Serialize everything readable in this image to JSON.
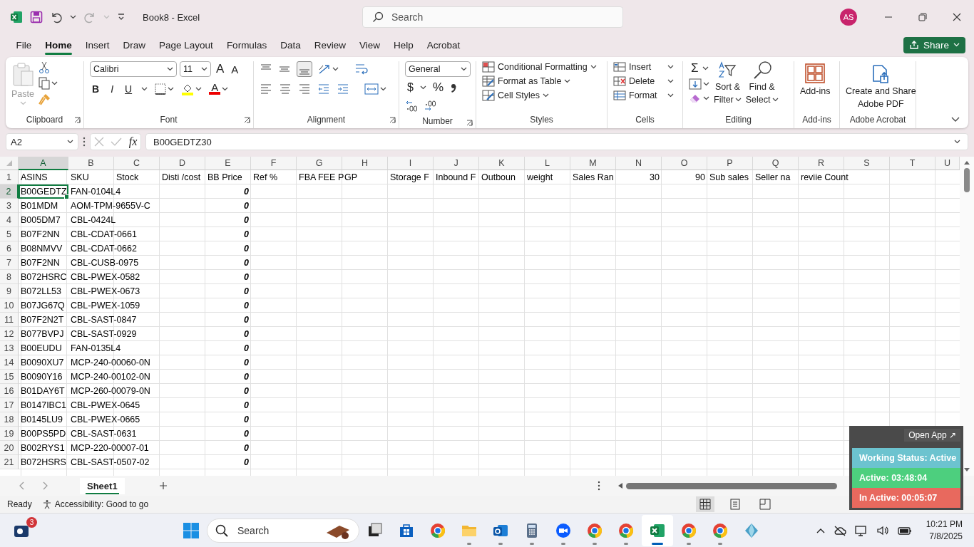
{
  "window": {
    "title": "Book8  -  Excel",
    "search_placeholder": "Search",
    "avatar": "AS"
  },
  "menu": {
    "tabs": [
      {
        "label": "File",
        "selected": false
      },
      {
        "label": "Home",
        "selected": true
      },
      {
        "label": "Insert",
        "selected": false
      },
      {
        "label": "Draw",
        "selected": false
      },
      {
        "label": "Page Layout",
        "selected": false
      },
      {
        "label": "Formulas",
        "selected": false
      },
      {
        "label": "Data",
        "selected": false
      },
      {
        "label": "Review",
        "selected": false
      },
      {
        "label": "View",
        "selected": false
      },
      {
        "label": "Help",
        "selected": false
      },
      {
        "label": "Acrobat",
        "selected": false
      }
    ],
    "share": "Share"
  },
  "ribbon": {
    "groups": [
      {
        "kind": "clipboard",
        "label": "Clipboard",
        "launcher": true,
        "paste": "Paste",
        "paste_disabled": true
      },
      {
        "kind": "font",
        "label": "Font",
        "launcher": true,
        "font_name": "Calibri",
        "font_size": "11",
        "grow": "A",
        "shrink": "A",
        "styles": [
          "B",
          "I",
          "U"
        ],
        "font_color": "A"
      },
      {
        "kind": "alignment",
        "label": "Alignment",
        "launcher": true,
        "vertical_align": [
          {
            "selected": false
          },
          {
            "selected": false
          },
          {
            "selected": true
          }
        ]
      },
      {
        "kind": "number",
        "label": "Number",
        "launcher": true,
        "format": "General",
        "currency": "$",
        "percent": "%"
      },
      {
        "kind": "styles",
        "label": "Styles",
        "launcher": false,
        "items": [
          "Conditional Formatting",
          "Format as Table",
          "Cell Styles"
        ]
      },
      {
        "kind": "cells",
        "label": "Cells",
        "launcher": false,
        "items": [
          "Insert",
          "Delete",
          "Format"
        ]
      },
      {
        "kind": "editing",
        "label": "Editing",
        "launcher": false,
        "sum": "Σ",
        "buttons": [
          [
            "Sort &",
            "Filter"
          ],
          [
            "Find &",
            "Select"
          ]
        ]
      },
      {
        "kind": "addins",
        "label": "Add-ins",
        "launcher": false,
        "button": [
          "Add-ins"
        ]
      },
      {
        "kind": "acrobat",
        "label": "Adobe Acrobat",
        "launcher": false,
        "button": [
          "Create and Share",
          "Adobe PDF"
        ]
      }
    ]
  },
  "formula_bar": {
    "name_box": "A2",
    "function_label": "fx",
    "value": "B00GEDTZ30"
  },
  "sheet": {
    "columns": [
      {
        "letter": "A",
        "selected": true
      },
      {
        "letter": "B",
        "selected": false
      },
      {
        "letter": "C",
        "selected": false
      },
      {
        "letter": "D",
        "selected": false
      },
      {
        "letter": "E",
        "selected": false
      },
      {
        "letter": "F",
        "selected": false
      },
      {
        "letter": "G",
        "selected": false
      },
      {
        "letter": "H",
        "selected": false
      },
      {
        "letter": "I",
        "selected": false
      },
      {
        "letter": "J",
        "selected": false
      },
      {
        "letter": "K",
        "selected": false
      },
      {
        "letter": "L",
        "selected": false
      },
      {
        "letter": "M",
        "selected": false
      },
      {
        "letter": "N",
        "selected": false
      },
      {
        "letter": "O",
        "selected": false
      },
      {
        "letter": "P",
        "selected": false
      },
      {
        "letter": "Q",
        "selected": false
      },
      {
        "letter": "R",
        "selected": false
      },
      {
        "letter": "S",
        "selected": false
      },
      {
        "letter": "T",
        "selected": false
      },
      {
        "letter": "U",
        "selected": false
      }
    ],
    "rows": [
      {
        "number": "1",
        "selected": false,
        "cells": {
          "A": {
            "text": "ASINS",
            "kind": "text"
          },
          "B": {
            "text": "SKU",
            "kind": "text"
          },
          "C": {
            "text": "Stock",
            "kind": "text"
          },
          "D": {
            "text": "Disti /cost",
            "kind": "text"
          },
          "E": {
            "text": "BB Price",
            "kind": "text"
          },
          "F": {
            "text": "Ref %",
            "kind": "text"
          },
          "G": {
            "text": "FBA FEE P",
            "kind": "text"
          },
          "H": {
            "text": "GP",
            "kind": "text"
          },
          "I": {
            "text": "Storage F",
            "kind": "text"
          },
          "J": {
            "text": "Inbound F",
            "kind": "text"
          },
          "K": {
            "text": "Outboun",
            "kind": "text"
          },
          "L": {
            "text": "weight",
            "kind": "text"
          },
          "M": {
            "text": "Sales Ran",
            "kind": "text"
          },
          "N": {
            "text": "30",
            "kind": "number"
          },
          "O": {
            "text": "90",
            "kind": "number"
          },
          "P": {
            "text": "Sub sales",
            "kind": "text"
          },
          "Q": {
            "text": "Seller na",
            "kind": "text"
          },
          "R": {
            "text": "reviie Count",
            "kind": "text"
          }
        }
      },
      {
        "number": "2",
        "selected": true,
        "cells": {
          "A": {
            "text": "B00GEDTZ",
            "kind": "text"
          },
          "B": {
            "text": "FAN-0104L4",
            "kind": "text"
          },
          "E": {
            "text": "0",
            "kind": "emphasis"
          }
        }
      },
      {
        "number": "3",
        "selected": false,
        "cells": {
          "A": {
            "text": "B01MDM",
            "kind": "text"
          },
          "B": {
            "text": "AOM-TPM-9655V-C",
            "kind": "text"
          },
          "E": {
            "text": "0",
            "kind": "emphasis"
          }
        }
      },
      {
        "number": "4",
        "selected": false,
        "cells": {
          "A": {
            "text": "B005DM7",
            "kind": "text"
          },
          "B": {
            "text": "CBL-0424L",
            "kind": "text"
          },
          "E": {
            "text": "0",
            "kind": "emphasis"
          }
        }
      },
      {
        "number": "5",
        "selected": false,
        "cells": {
          "A": {
            "text": "B07F2NN",
            "kind": "text"
          },
          "B": {
            "text": "CBL-CDAT-0661",
            "kind": "text"
          },
          "E": {
            "text": "0",
            "kind": "emphasis"
          }
        }
      },
      {
        "number": "6",
        "selected": false,
        "cells": {
          "A": {
            "text": "B08NMVV",
            "kind": "text"
          },
          "B": {
            "text": "CBL-CDAT-0662",
            "kind": "text"
          },
          "E": {
            "text": "0",
            "kind": "emphasis"
          }
        }
      },
      {
        "number": "7",
        "selected": false,
        "cells": {
          "A": {
            "text": "B07F2NN",
            "kind": "text"
          },
          "B": {
            "text": "CBL-CUSB-0975",
            "kind": "text"
          },
          "E": {
            "text": "0",
            "kind": "emphasis"
          }
        }
      },
      {
        "number": "8",
        "selected": false,
        "cells": {
          "A": {
            "text": "B072HSRC",
            "kind": "text"
          },
          "B": {
            "text": "CBL-PWEX-0582",
            "kind": "text"
          },
          "E": {
            "text": "0",
            "kind": "emphasis"
          }
        }
      },
      {
        "number": "9",
        "selected": false,
        "cells": {
          "A": {
            "text": "B072LL53",
            "kind": "text"
          },
          "B": {
            "text": "CBL-PWEX-0673",
            "kind": "text"
          },
          "E": {
            "text": "0",
            "kind": "emphasis"
          }
        }
      },
      {
        "number": "10",
        "selected": false,
        "cells": {
          "A": {
            "text": "B07JG67Q",
            "kind": "text"
          },
          "B": {
            "text": "CBL-PWEX-1059",
            "kind": "text"
          },
          "E": {
            "text": "0",
            "kind": "emphasis"
          }
        }
      },
      {
        "number": "11",
        "selected": false,
        "cells": {
          "A": {
            "text": "B07F2N2T",
            "kind": "text"
          },
          "B": {
            "text": "CBL-SAST-0847",
            "kind": "text"
          },
          "E": {
            "text": "0",
            "kind": "emphasis"
          }
        }
      },
      {
        "number": "12",
        "selected": false,
        "cells": {
          "A": {
            "text": "B077BVPJ",
            "kind": "text"
          },
          "B": {
            "text": "CBL-SAST-0929",
            "kind": "text"
          },
          "E": {
            "text": "0",
            "kind": "emphasis"
          }
        }
      },
      {
        "number": "13",
        "selected": false,
        "cells": {
          "A": {
            "text": "B00EUDU",
            "kind": "text"
          },
          "B": {
            "text": "FAN-0135L4",
            "kind": "text"
          },
          "E": {
            "text": "0",
            "kind": "emphasis"
          }
        }
      },
      {
        "number": "14",
        "selected": false,
        "cells": {
          "A": {
            "text": "B0090XU7",
            "kind": "text"
          },
          "B": {
            "text": "MCP-240-00060-0N",
            "kind": "text"
          },
          "E": {
            "text": "0",
            "kind": "emphasis"
          }
        }
      },
      {
        "number": "15",
        "selected": false,
        "cells": {
          "A": {
            "text": "B0090Y16",
            "kind": "text"
          },
          "B": {
            "text": "MCP-240-00102-0N",
            "kind": "text"
          },
          "E": {
            "text": "0",
            "kind": "emphasis"
          }
        }
      },
      {
        "number": "16",
        "selected": false,
        "cells": {
          "A": {
            "text": "B01DAY6T",
            "kind": "text"
          },
          "B": {
            "text": "MCP-260-00079-0N",
            "kind": "text"
          },
          "E": {
            "text": "0",
            "kind": "emphasis"
          }
        }
      },
      {
        "number": "17",
        "selected": false,
        "cells": {
          "A": {
            "text": "B0147IBC1",
            "kind": "text"
          },
          "B": {
            "text": "CBL-PWEX-0645",
            "kind": "text"
          },
          "E": {
            "text": "0",
            "kind": "emphasis"
          }
        }
      },
      {
        "number": "18",
        "selected": false,
        "cells": {
          "A": {
            "text": "B0145LU9",
            "kind": "text"
          },
          "B": {
            "text": "CBL-PWEX-0665",
            "kind": "text"
          },
          "E": {
            "text": "0",
            "kind": "emphasis"
          }
        }
      },
      {
        "number": "19",
        "selected": false,
        "cells": {
          "A": {
            "text": "B00PS5PD",
            "kind": "text"
          },
          "B": {
            "text": "CBL-SAST-0631",
            "kind": "text"
          },
          "E": {
            "text": "0",
            "kind": "emphasis"
          }
        }
      },
      {
        "number": "20",
        "selected": false,
        "cells": {
          "A": {
            "text": "B002RYS1",
            "kind": "text"
          },
          "B": {
            "text": "MCP-220-00007-01",
            "kind": "text"
          },
          "E": {
            "text": "0",
            "kind": "emphasis"
          }
        }
      },
      {
        "number": "21",
        "selected": false,
        "cells": {
          "A": {
            "text": "B072HSRS",
            "kind": "text"
          },
          "B": {
            "text": "CBL-SAST-0507-02",
            "kind": "text"
          },
          "E": {
            "text": "0",
            "kind": "emphasis"
          }
        }
      }
    ]
  },
  "sheet_tabs": [
    {
      "label": "Sheet1",
      "selected": true
    }
  ],
  "status_bar": {
    "mode": "Ready",
    "accessibility": "Accessibility: Good to go",
    "views": [
      {
        "kind": "normal",
        "selected": true
      },
      {
        "kind": "page-layout",
        "selected": false
      },
      {
        "kind": "page-break",
        "selected": false
      }
    ]
  },
  "tracker": {
    "open_app": "Open App ↗",
    "status": "Working Status: Active",
    "active": "Active: 03:48:04",
    "inactive": "In Active: 00:05:07"
  },
  "taskbar": {
    "badge": "3",
    "search_placeholder": "Search",
    "apps": [
      {
        "kind": "taskview",
        "running": false,
        "selected": false
      },
      {
        "kind": "store",
        "running": false,
        "selected": false
      },
      {
        "kind": "chrome",
        "running": false,
        "selected": false
      },
      {
        "kind": "files",
        "running": true,
        "selected": false
      },
      {
        "kind": "outlook",
        "running": true,
        "selected": false
      },
      {
        "kind": "calculator",
        "running": true,
        "selected": false
      },
      {
        "kind": "zoom",
        "running": true,
        "selected": false
      },
      {
        "kind": "chrome",
        "running": true,
        "selected": false
      },
      {
        "kind": "chrome",
        "running": true,
        "selected": false
      },
      {
        "kind": "excel",
        "running": true,
        "selected": true
      },
      {
        "kind": "chrome",
        "running": true,
        "selected": false
      },
      {
        "kind": "chrome",
        "running": true,
        "selected": false
      },
      {
        "kind": "diamond",
        "running": false,
        "selected": false
      }
    ],
    "time": "10:21 PM",
    "date": "7/8/2025"
  }
}
